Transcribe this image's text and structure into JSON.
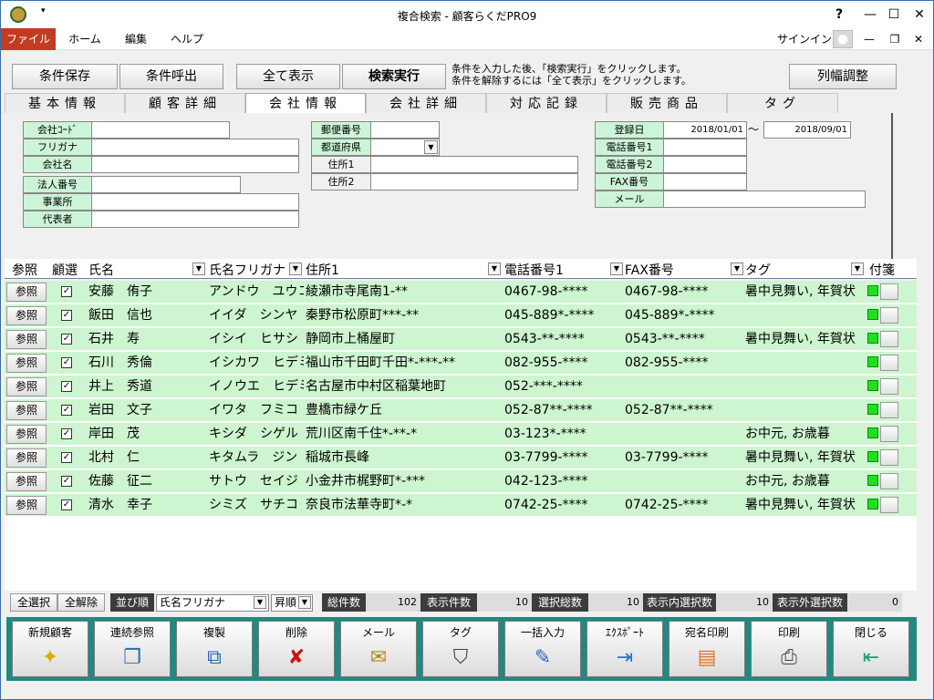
{
  "window": {
    "title": "複合検索 - 顧客らくだPRO9",
    "help_icon": "?",
    "app_icon": "app-logo",
    "controls": [
      "?",
      "—",
      "☐",
      "✕"
    ]
  },
  "menu": {
    "items": [
      "ファイル",
      "ホーム",
      "編集",
      "ヘルプ"
    ],
    "signin": "サインイン"
  },
  "top_buttons": {
    "save": "条件保存",
    "recall": "条件呼出",
    "show_all": "全て表示",
    "search": "検索実行",
    "column_adjust": "列幅調整"
  },
  "instructions": {
    "line1": "条件を入力した後、「検索実行」をクリックします。",
    "line2": "条件を解除するには「全て表示」をクリックします。"
  },
  "tabs": [
    "基本情報",
    "顧客詳細",
    "会社情報",
    "会社詳細",
    "対応記録",
    "販売商品",
    "タグ"
  ],
  "active_tab": 2,
  "form": {
    "company_code": "会社ｺｰﾄﾞ",
    "furigana": "フリガナ",
    "company_name": "会社名",
    "corp_number": "法人番号",
    "office": "事業所",
    "representative": "代表者",
    "postal": "郵便番号",
    "prefecture": "都道府県",
    "address1": "住所1",
    "address2": "住所2",
    "reg_date": "登録日",
    "reg_from": "2018/01/01",
    "tilde": "～",
    "reg_to": "2018/09/01",
    "phone1": "電話番号1",
    "phone2": "電話番号2",
    "fax": "FAX番号",
    "mail": "メール"
  },
  "grid": {
    "headers": {
      "ref": "参照",
      "select": "顧選",
      "name": "氏名",
      "kana": "氏名フリガナ",
      "address": "住所1",
      "phone": "電話番号1",
      "fax": "FAX番号",
      "tag": "タグ",
      "sticky": "付箋"
    },
    "ref_label": "参照",
    "rows": [
      {
        "name": "安藤　侑子",
        "kana": "アンドウ　ユウコ",
        "address": "綾瀬市寺尾南1-**",
        "phone": "0467-98-****",
        "fax": "0467-98-****",
        "tag": "暑中見舞い, 年賀状"
      },
      {
        "name": "飯田　信也",
        "kana": "イイダ　シンヤ",
        "address": "秦野市松原町***-**",
        "phone": "045-889*-****",
        "fax": "045-889*-****",
        "tag": ""
      },
      {
        "name": "石井　寿",
        "kana": "イシイ　ヒサシ",
        "address": "静岡市上桶屋町",
        "phone": "0543-**-****",
        "fax": "0543-**-****",
        "tag": "暑中見舞い, 年賀状"
      },
      {
        "name": "石川　秀倫",
        "kana": "イシカワ　ヒデミチ",
        "address": "福山市千田町千田*-***-**",
        "phone": "082-955-****",
        "fax": "082-955-****",
        "tag": ""
      },
      {
        "name": "井上　秀道",
        "kana": "イノウエ　ヒデミチ",
        "address": "名古屋市中村区稲葉地町",
        "phone": "052-***-****",
        "fax": "",
        "tag": ""
      },
      {
        "name": "岩田　文子",
        "kana": "イワタ　フミコ",
        "address": "豊橋市緑ケ丘",
        "phone": "052-87**-****",
        "fax": "052-87**-****",
        "tag": ""
      },
      {
        "name": "岸田　茂",
        "kana": "キシダ　シゲル",
        "address": "荒川区南千住*-**-*",
        "phone": "03-123*-****",
        "fax": "",
        "tag": "お中元, お歳暮"
      },
      {
        "name": "北村　仁",
        "kana": "キタムラ　ジン",
        "address": "稲城市長峰",
        "phone": "03-7799-****",
        "fax": "03-7799-****",
        "tag": "暑中見舞い, 年賀状"
      },
      {
        "name": "佐藤　征二",
        "kana": "サトウ　セイジ",
        "address": "小金井市梶野町*-***",
        "phone": "042-123-****",
        "fax": "",
        "tag": "お中元, お歳暮"
      },
      {
        "name": "清水　幸子",
        "kana": "シミズ　サチコ",
        "address": "奈良市法華寺町*-*",
        "phone": "0742-25-****",
        "fax": "0742-25-****",
        "tag": "暑中見舞い, 年賀状"
      }
    ]
  },
  "status": {
    "select_all": "全選択",
    "deselect_all": "全解除",
    "sort_label": "並び順",
    "sort_field": "氏名フリガナ",
    "sort_order": "昇順",
    "total_label": "総件数",
    "total": "102",
    "shown_label": "表示件数",
    "shown": "10",
    "selected_label": "選択総数",
    "selected": "10",
    "in_view_label": "表示内選択数",
    "in_view": "10",
    "out_view_label": "表示外選択数",
    "out_view": "0"
  },
  "toolbar": [
    {
      "label": "新規顧客",
      "icon": "✦"
    },
    {
      "label": "連続参照",
      "icon": "❐"
    },
    {
      "label": "複製",
      "icon": "⧉"
    },
    {
      "label": "削除",
      "icon": "✘"
    },
    {
      "label": "メール",
      "icon": "✉"
    },
    {
      "label": "タグ",
      "icon": "⛉"
    },
    {
      "label": "一括入力",
      "icon": "✎"
    },
    {
      "label": "ｴｸｽﾎﾟｰﾄ",
      "icon": "⇥"
    },
    {
      "label": "宛名印刷",
      "icon": "▤"
    },
    {
      "label": "印刷",
      "icon": "⎙"
    },
    {
      "label": "閉じる",
      "icon": "⇤"
    }
  ],
  "colors": {
    "row_bg": "#cdf5cf",
    "label_bg": "#ccf5d8",
    "toolbar_bg": "#1e8a80",
    "menu_file_bg": "#c23b22",
    "sticky_green": "#1fe01f"
  }
}
